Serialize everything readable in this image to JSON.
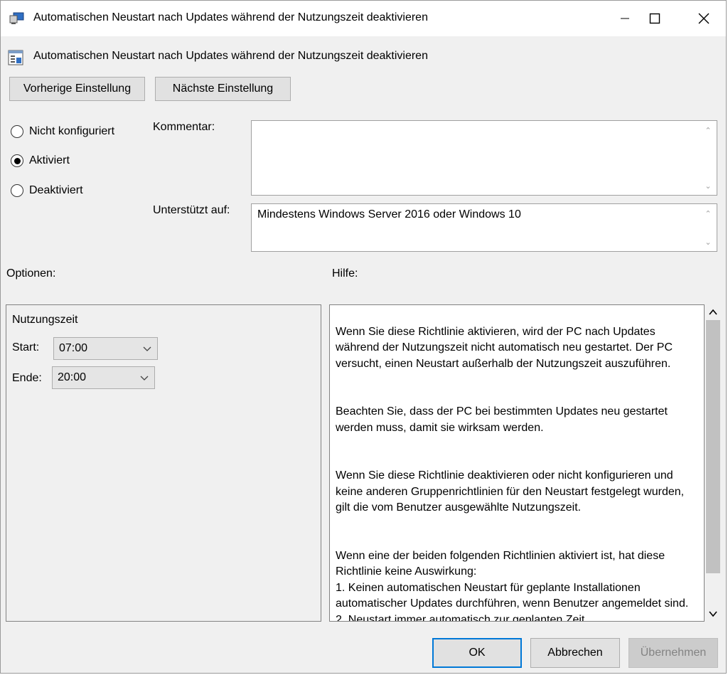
{
  "window": {
    "title": "Automatischen Neustart nach Updates während der Nutzungszeit deaktivieren"
  },
  "policy": {
    "title": "Automatischen Neustart nach Updates während der Nutzungszeit deaktivieren",
    "prev_button": "Vorherige Einstellung",
    "next_button": "Nächste Einstellung"
  },
  "state": {
    "options": [
      {
        "label": "Nicht konfiguriert",
        "selected": false
      },
      {
        "label": "Aktiviert",
        "selected": true
      },
      {
        "label": "Deaktiviert",
        "selected": false
      }
    ]
  },
  "comment": {
    "label": "Kommentar:",
    "value": ""
  },
  "supported": {
    "label": "Unterstützt auf:",
    "value": "Mindestens Windows Server 2016 oder Windows 10"
  },
  "options_section": {
    "label": "Optionen:",
    "group_title": "Nutzungszeit",
    "start_label": "Start:",
    "start_value": "07:00",
    "end_label": "Ende:",
    "end_value": "20:00"
  },
  "help": {
    "label": "Hilfe:",
    "paragraphs": [
      "Wenn Sie diese Richtlinie aktivieren, wird der PC nach Updates während der Nutzungszeit nicht automatisch neu gestartet. Der PC versucht, einen Neustart außerhalb der Nutzungszeit auszuführen.",
      "Beachten Sie, dass der PC bei bestimmten Updates neu gestartet werden muss, damit sie wirksam werden.",
      "Wenn Sie diese Richtlinie deaktivieren oder nicht konfigurieren und keine anderen Gruppenrichtlinien für den Neustart festgelegt wurden, gilt die vom Benutzer ausgewählte Nutzungszeit.",
      "Wenn eine der beiden folgenden Richtlinien aktiviert ist, hat diese Richtlinie keine Auswirkung:\n    1. Keinen automatischen Neustart für geplante Installationen automatischer Updates durchführen, wenn Benutzer angemeldet sind.\n    2. Neustart immer automatisch zur geplanten Zeit"
    ]
  },
  "footer": {
    "ok": "OK",
    "cancel": "Abbrechen",
    "apply": "Übernehmen"
  }
}
